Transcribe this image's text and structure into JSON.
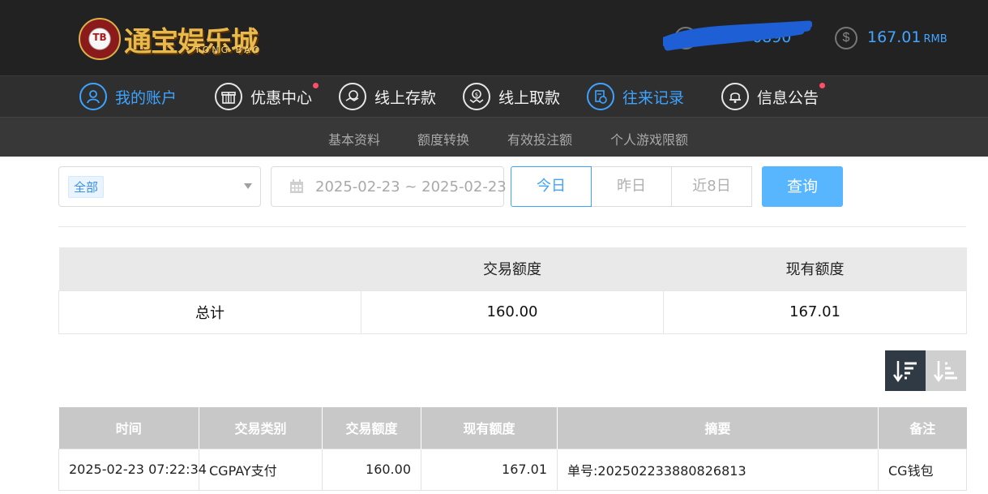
{
  "header": {
    "logo_badge": "TB",
    "logo_text": "通宝娱乐城",
    "logo_sub": "TONG BAO",
    "username_visible": "6890",
    "balance": "167.01",
    "currency": "RMB"
  },
  "nav": [
    {
      "label": "我的账户",
      "icon": "user-circle-icon",
      "active": true,
      "dot": false
    },
    {
      "label": "优惠中心",
      "icon": "gift-icon",
      "active": false,
      "dot": true
    },
    {
      "label": "线上存款",
      "icon": "deposit-icon",
      "active": false,
      "dot": false
    },
    {
      "label": "线上取款",
      "icon": "withdraw-icon",
      "active": false,
      "dot": false
    },
    {
      "label": "往来记录",
      "icon": "records-icon",
      "active": true,
      "dot": false
    },
    {
      "label": "信息公告",
      "icon": "bell-icon",
      "active": false,
      "dot": true
    }
  ],
  "subnav": [
    "基本资料",
    "额度转换",
    "有效投注额",
    "个人游戏限额"
  ],
  "filter": {
    "type_selected": "全部",
    "date_range": "2025-02-23 ~ 2025-02-23",
    "quick": [
      "今日",
      "昨日",
      "近8日"
    ],
    "quick_active": "今日",
    "search_label": "查询"
  },
  "summary": {
    "headers": [
      "",
      "交易额度",
      "现有额度"
    ],
    "row": [
      "总计",
      "160.00",
      "167.01"
    ]
  },
  "records": {
    "headers": [
      "时间",
      "交易类别",
      "交易额度",
      "现有额度",
      "摘要",
      "备注"
    ],
    "rows": [
      [
        "2025-02-23 07:22:34",
        "CGPAY支付",
        "160.00",
        "167.01",
        "单号:202502233880826813",
        "CG钱包"
      ]
    ]
  },
  "colors": {
    "accent": "#3ea3ff",
    "header_bg": "#222222",
    "nav_bg": "#2f2f2f",
    "subnav_bg": "#383838",
    "search_btn": "#57b6ff",
    "notify_dot": "#ff4d6a"
  }
}
